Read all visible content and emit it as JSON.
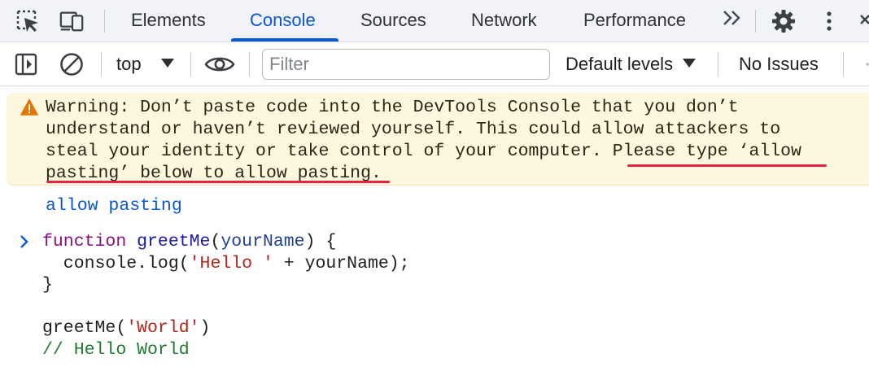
{
  "tabs": {
    "items": [
      "Elements",
      "Console",
      "Sources",
      "Network",
      "Performance"
    ],
    "active": "Console",
    "more_icon": "double-chevron-right-icon",
    "settings_icon": "gear-icon",
    "menu_icon": "kebab-menu-icon"
  },
  "toolbar": {
    "context_label": "top",
    "filter_placeholder": "Filter",
    "filter_value": "",
    "levels_label": "Default levels",
    "issues_label": "No Issues"
  },
  "console": {
    "warning_lines": [
      "Warning: Don’t paste code into the DevTools Console that you don’t",
      "understand or haven’t reviewed yourself. This could allow attackers to",
      "steal your identity or take control of your computer. Please type ‘allow",
      "pasting’ below to allow pasting."
    ],
    "echo_text": "allow pasting",
    "code": {
      "line1": {
        "keyword": "function",
        "name": "greetMe",
        "param": "yourName",
        "rest": ") {"
      },
      "line2": {
        "prefix": "  console.log(",
        "string": "'Hello '",
        "rest": " + yourName);"
      },
      "line3": "}",
      "line5": {
        "prefix": "greetMe(",
        "string": "'World'",
        "rest": ")"
      },
      "line6": "// Hello World"
    }
  },
  "colors": {
    "accent": "#0b57d0",
    "warning_bg": "#fef7e0",
    "warning_icon": "#e37400",
    "highlight_underline": "#e8233f",
    "keyword": "#881280",
    "string": "#b3261e",
    "comment": "#1e7a2e"
  }
}
